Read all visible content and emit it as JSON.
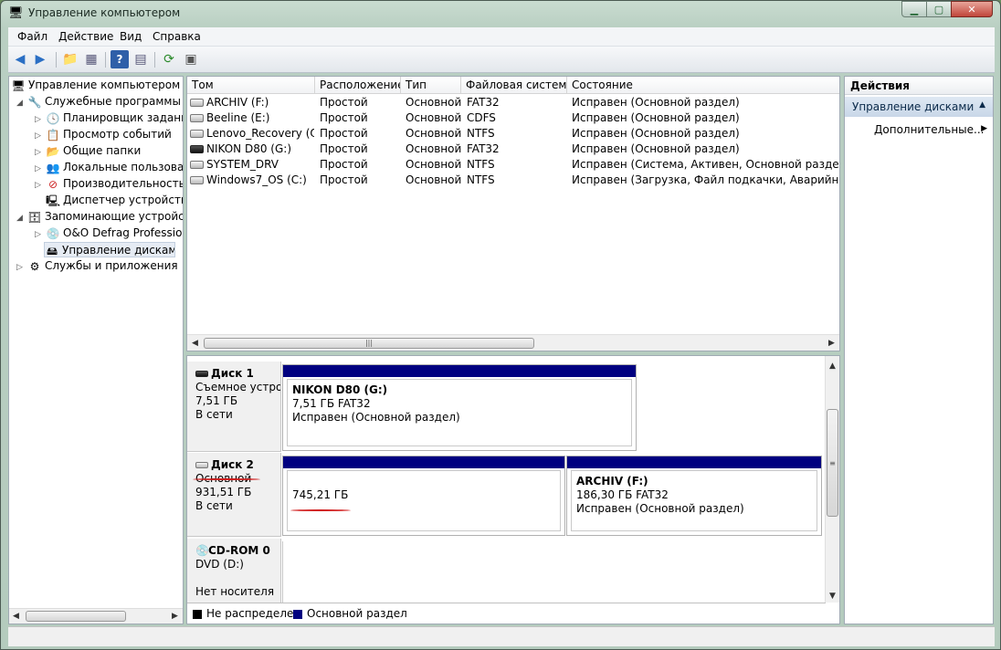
{
  "window": {
    "title": "Управление компьютером"
  },
  "menu": [
    "Файл",
    "Действие",
    "Вид",
    "Справка"
  ],
  "tree": {
    "root": "Управление компьютером (л",
    "system_tools": "Служебные программы",
    "scheduler": "Планировщик заданий",
    "event_viewer": "Просмотр событий",
    "shared_folders": "Общие папки",
    "local_users": "Локальные пользовате",
    "performance": "Производительность",
    "device_manager": "Диспетчер устройств",
    "storage": "Запоминающие устройст",
    "defrag": "O&O Defrag Profession",
    "disk_mgmt": "Управление дисками",
    "services": "Службы и приложения"
  },
  "columns": [
    "Том",
    "Расположение",
    "Тип",
    "Файловая система",
    "Состояние"
  ],
  "volumes": [
    {
      "name": "ARCHIV (F:)",
      "layout": "Простой",
      "type": "Основной",
      "fs": "FAT32",
      "status": "Исправен (Основной раздел)"
    },
    {
      "name": "Beeline (E:)",
      "layout": "Простой",
      "type": "Основной",
      "fs": "CDFS",
      "status": "Исправен (Основной раздел)"
    },
    {
      "name": "Lenovo_Recovery (Q:)",
      "layout": "Простой",
      "type": "Основной",
      "fs": "NTFS",
      "status": "Исправен (Основной раздел)"
    },
    {
      "name": "NIKON D80 (G:)",
      "layout": "Простой",
      "type": "Основной",
      "fs": "FAT32",
      "status": "Исправен (Основной раздел)"
    },
    {
      "name": "SYSTEM_DRV",
      "layout": "Простой",
      "type": "Основной",
      "fs": "NTFS",
      "status": "Исправен (Система, Активен, Основной раздел)"
    },
    {
      "name": "Windows7_OS (C:)",
      "layout": "Простой",
      "type": "Основной",
      "fs": "NTFS",
      "status": "Исправен (Загрузка, Файл подкачки, Аварийный дам"
    }
  ],
  "disks": [
    {
      "name": "Диск 1",
      "type": "Съемное устрой",
      "size": "7,51 ГБ",
      "state": "В сети"
    },
    {
      "name": "Диск 2",
      "type": "Основной",
      "size": "931,51 ГБ",
      "state": "В сети"
    },
    {
      "name": "CD-ROM 0",
      "type": "DVD (D:)",
      "size": "",
      "state": "Нет носителя"
    }
  ],
  "partitions": {
    "p1": {
      "name": "NIKON D80  (G:)",
      "size": "7,51 ГБ FAT32",
      "status": "Исправен (Основной раздел)"
    },
    "p2": {
      "size": "745,21 ГБ"
    },
    "p3": {
      "name": "ARCHIV  (F:)",
      "size": "186,30 ГБ FAT32",
      "status": "Исправен (Основной раздел)"
    }
  },
  "legend": [
    {
      "label": "Не распределен",
      "color": "#000000"
    },
    {
      "label": "Основной раздел",
      "color": "#000080"
    }
  ],
  "actions": {
    "header": "Действия",
    "section": "Управление дисками",
    "item": "Дополнительные..."
  },
  "colors": {
    "partition_bar": "#000080",
    "annotation": "#d01818"
  }
}
